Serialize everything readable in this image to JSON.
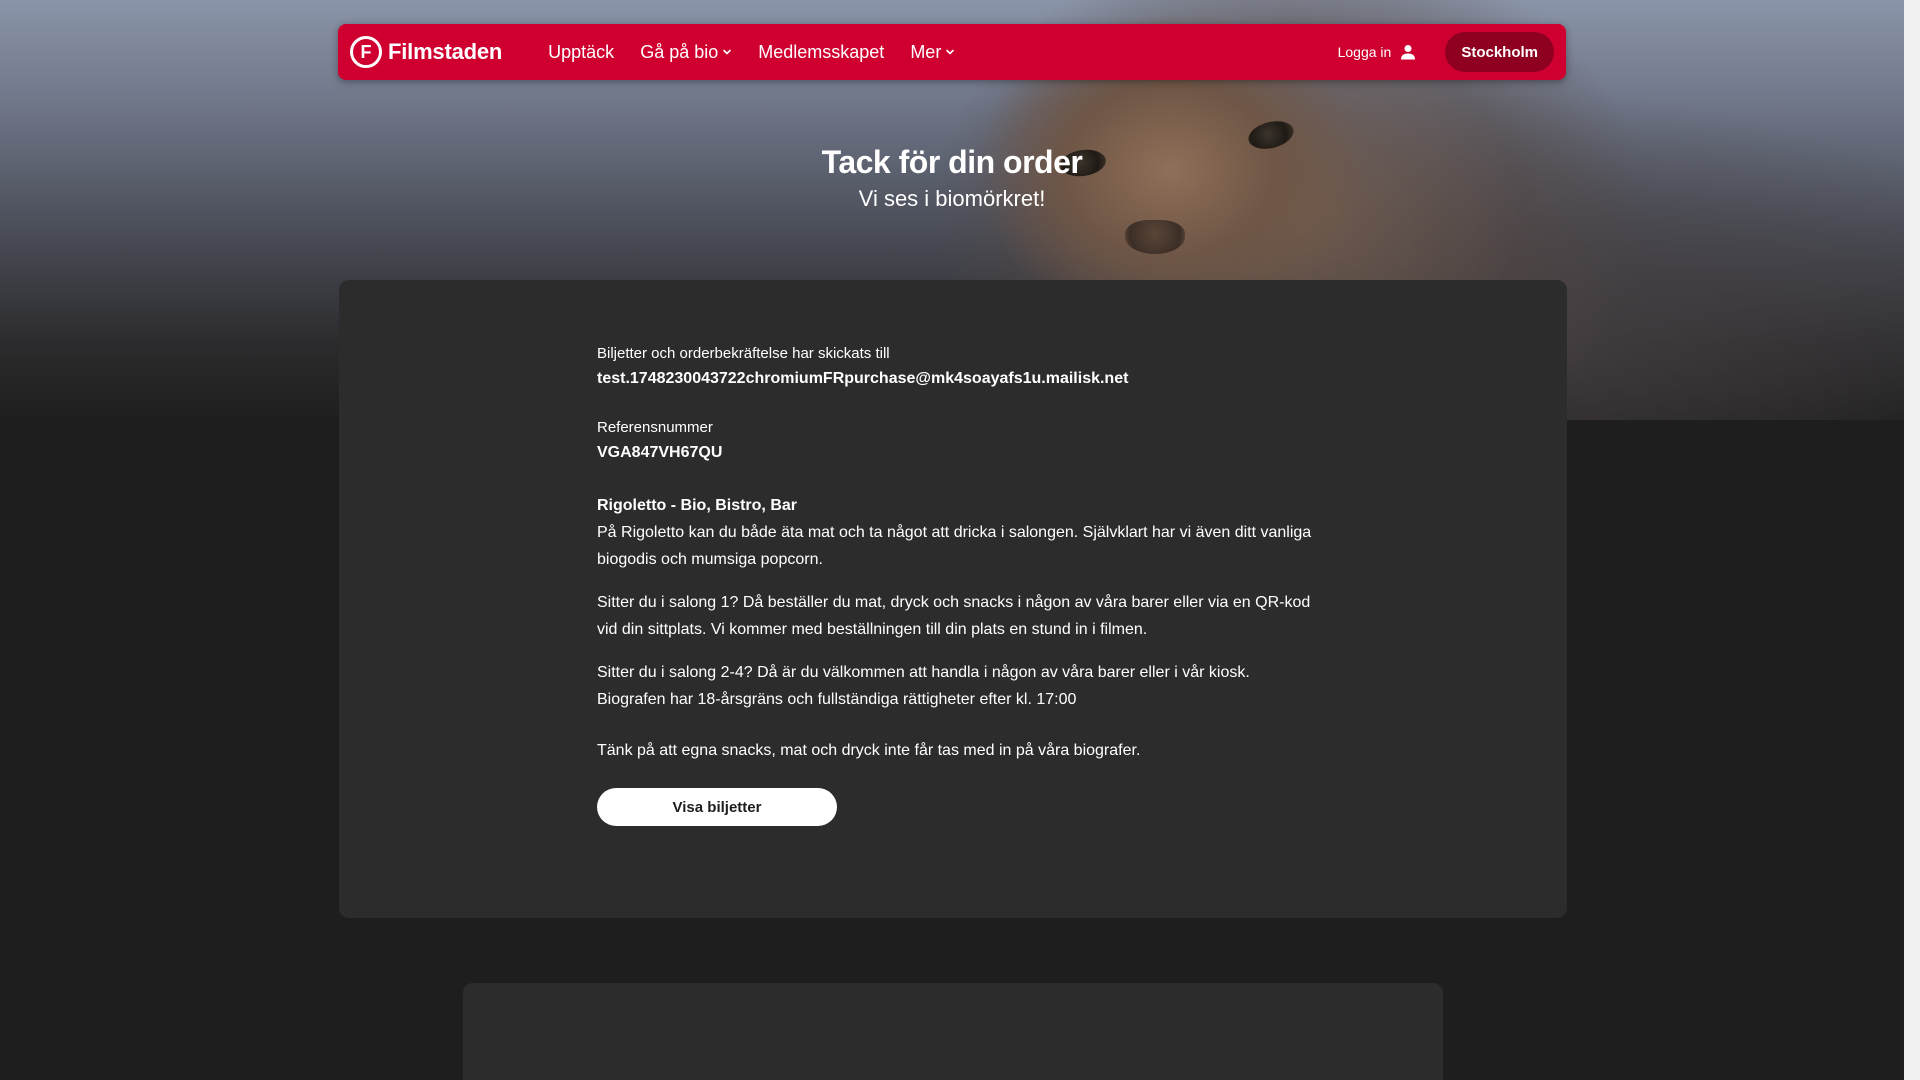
{
  "nav": {
    "brand": "Filmstaden",
    "brand_mark": "F",
    "links": [
      {
        "label": "Upptäck",
        "has_dropdown": false
      },
      {
        "label": "Gå på bio",
        "has_dropdown": true
      },
      {
        "label": "Medlemsskapet",
        "has_dropdown": false
      },
      {
        "label": "Mer",
        "has_dropdown": true
      }
    ],
    "login_label": "Logga in",
    "city_label": "Stockholm",
    "accent_color": "#cf0030"
  },
  "hero": {
    "title": "Tack för din order",
    "subtitle": "Vi ses i biomörkret!"
  },
  "order": {
    "sent_to_label": "Biljetter och orderbekräftelse har skickats till",
    "email": "test.1748230043722chromiumFRpurchase@mk4soayafs1u.mailisk.net",
    "reference_label": "Referensnummer",
    "reference": "VGA847VH67QU",
    "venue_title": "Rigoletto - Bio, Bistro, Bar",
    "venue_para1": "På Rigoletto kan du både äta mat och ta något att dricka i salongen. Självklart har vi även ditt vanliga biogodis och mumsiga popcorn.",
    "venue_para2": "Sitter du i salong 1? Då beställer du mat, dryck och snacks i någon av våra barer eller via en QR-kod vid din sittplats. Vi kommer med beställningen till din plats en stund in i filmen.",
    "venue_para3": "Sitter du i salong 2-4? Då är du välkommen att handla i någon av våra barer eller i vår kiosk.",
    "venue_para4": "Biografen har 18-årsgräns och fullständiga rättigheter efter kl. 17:00",
    "venue_para5": "Tänk på att egna snacks, mat och dryck inte får tas med in på våra biografer.",
    "show_tickets_label": "Visa biljetter"
  }
}
